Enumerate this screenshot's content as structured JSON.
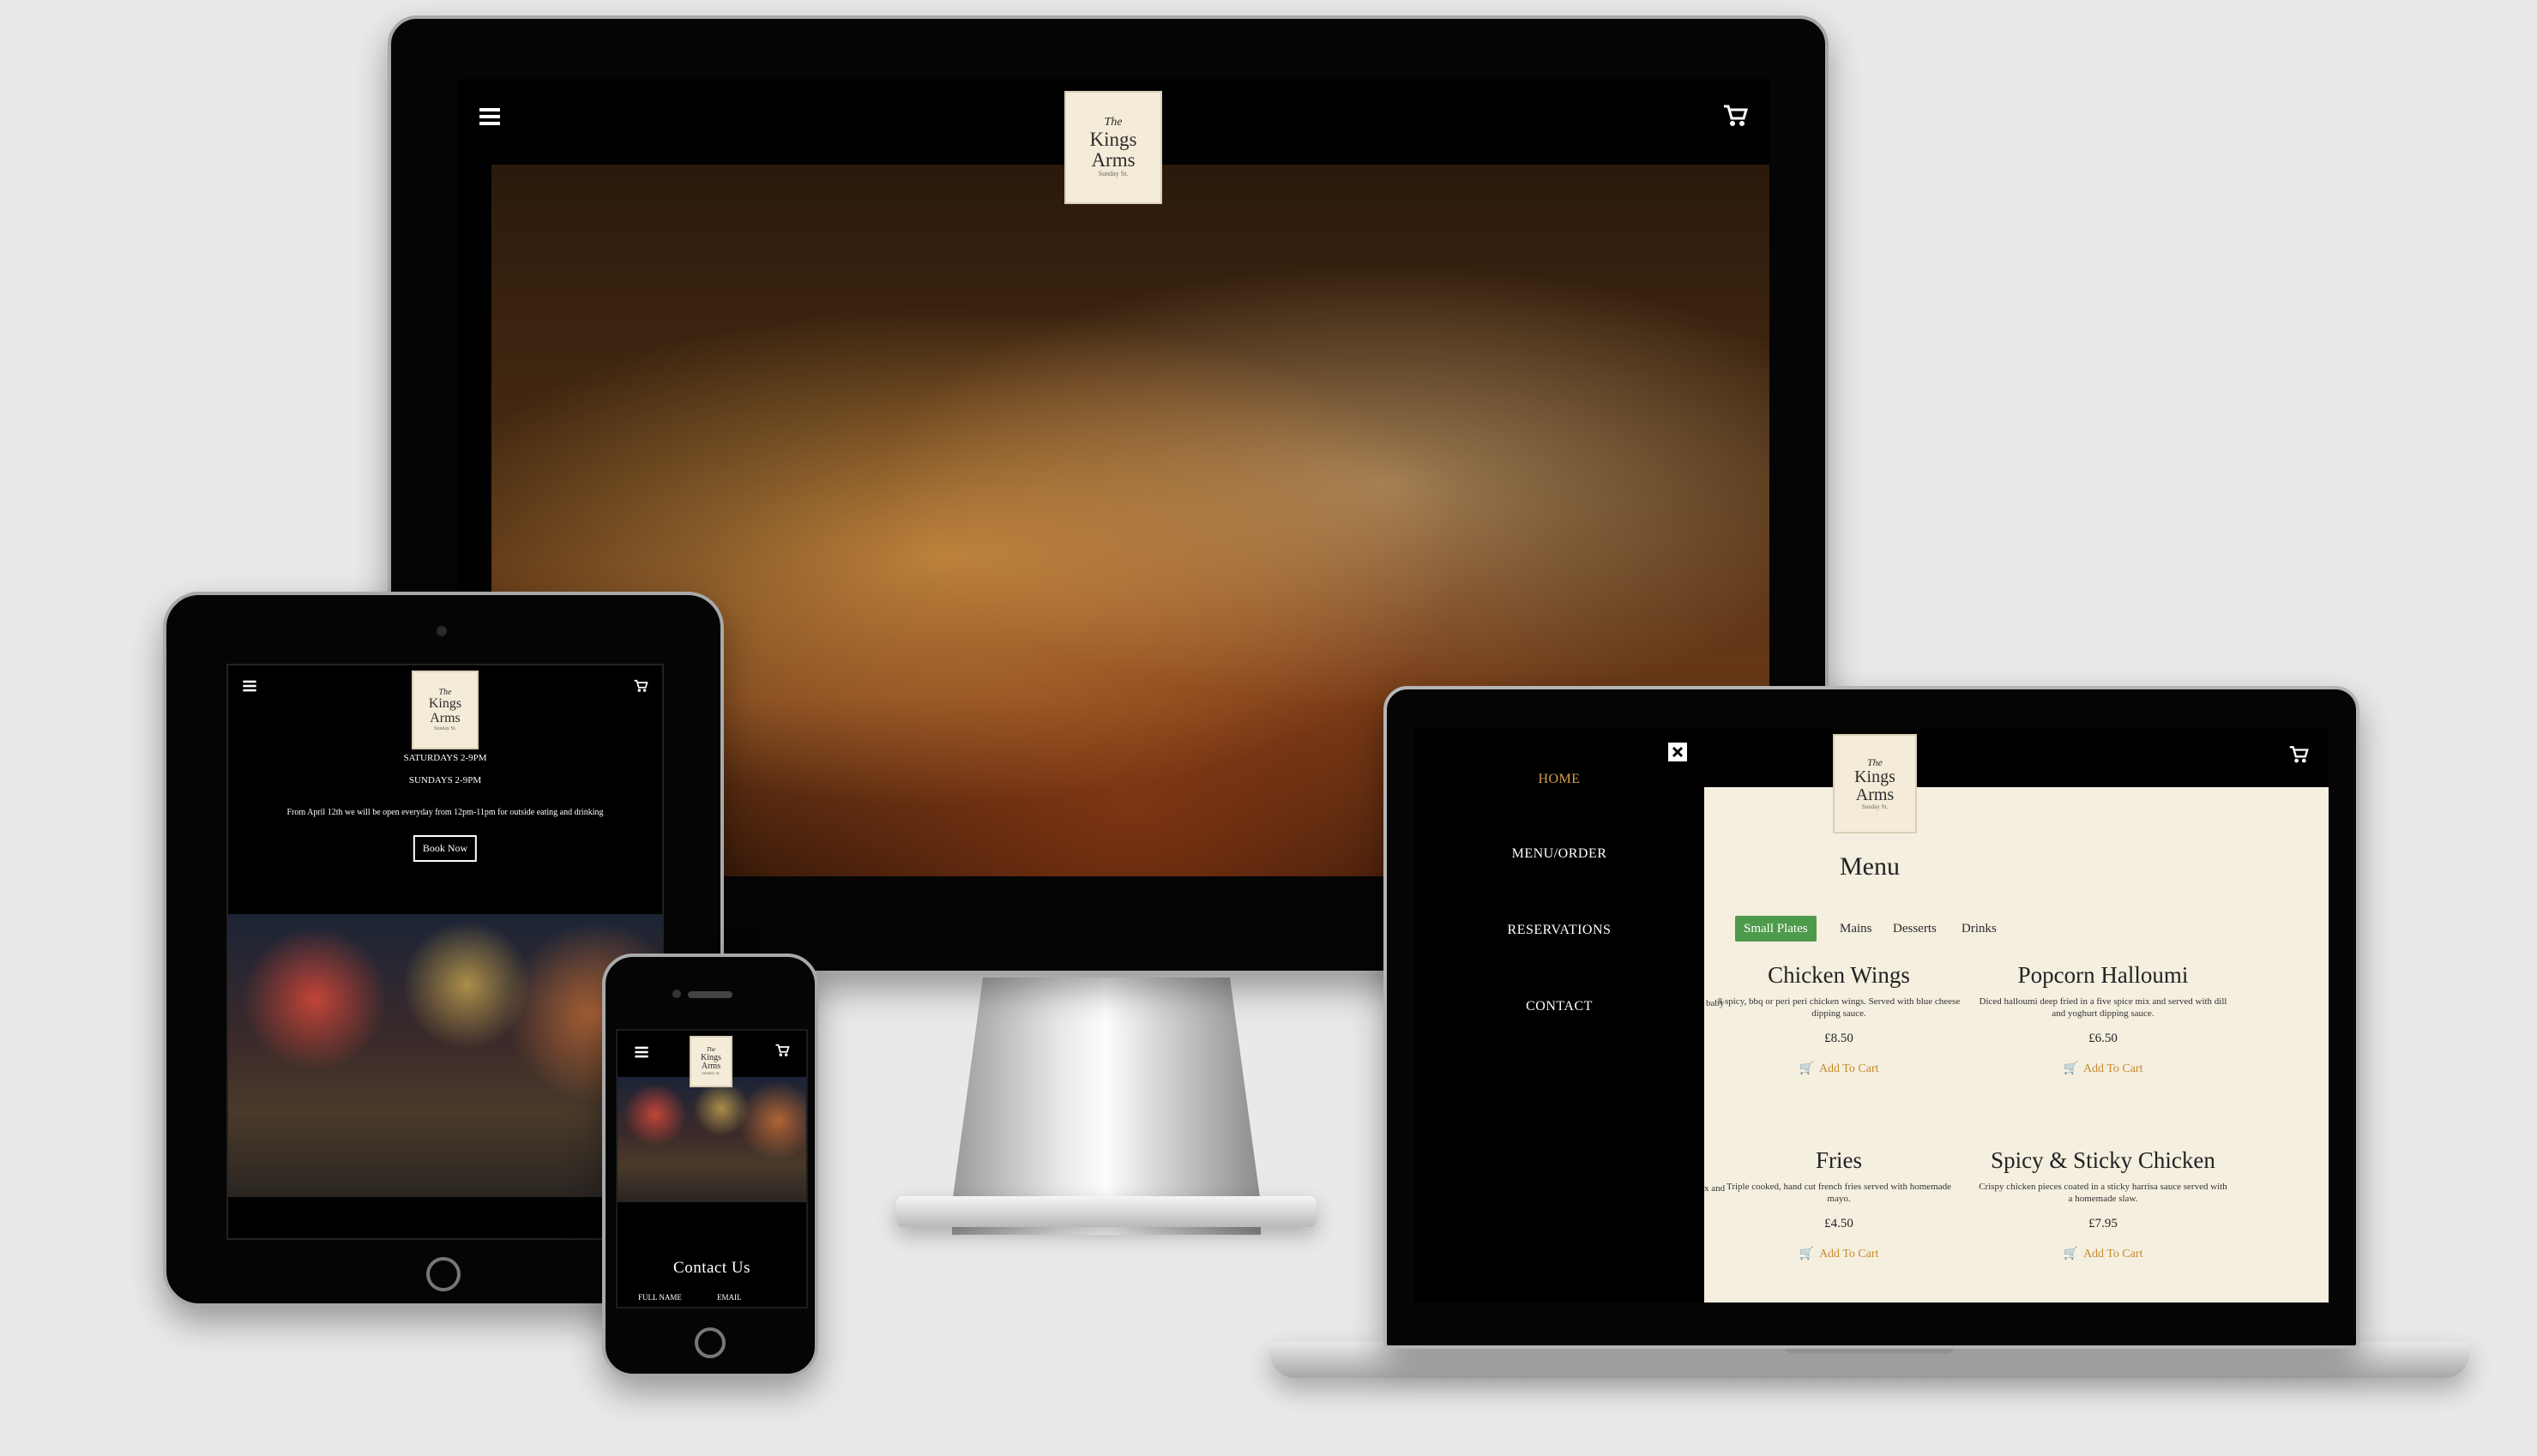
{
  "brand": {
    "logo_the": "The",
    "logo_line1": "Kings",
    "logo_line2": "Arms",
    "logo_small": "Sunday St."
  },
  "icons": {
    "menu": "hamburger-icon",
    "cart": "cart-icon",
    "close": "close-icon"
  },
  "colors": {
    "accent": "#d4a04a",
    "panel": "#f5efe0",
    "active_tab": "#4c9a4a"
  },
  "laptop": {
    "nav": [
      {
        "label": "HOME",
        "active": true
      },
      {
        "label": "MENU/ORDER",
        "active": false
      },
      {
        "label": "RESERVATIONS",
        "active": false
      },
      {
        "label": "CONTACT",
        "active": false
      }
    ],
    "menu_title": "Menu",
    "tabs": [
      "Small Plates",
      "Mains",
      "Desserts",
      "Drinks"
    ],
    "left_fragments": [
      "baby",
      "x and"
    ],
    "items": [
      {
        "name": "Chicken Wings",
        "description": "8 spicy, bbq or peri peri chicken wings. Served with blue cheese dipping sauce.",
        "price": "£8.50",
        "add": "Add To Cart"
      },
      {
        "name": "Popcorn Halloumi",
        "description": "Diced halloumi deep fried in a five spice mix and served with dill and yoghurt dipping sauce.",
        "price": "£6.50",
        "add": "Add To Cart"
      },
      {
        "name": "Fries",
        "description": "Triple cooked, hand cut french fries served with homemade mayo.",
        "price": "£4.50",
        "add": "Add To Cart"
      },
      {
        "name": "Spicy & Sticky Chicken",
        "description": "Crispy chicken pieces coated in a sticky harrisa sauce served with a homemade slaw.",
        "price": "£7.95",
        "add": "Add To Cart"
      }
    ]
  },
  "tablet": {
    "line1": "SATURDAYS 2-9PM",
    "line2": "SUNDAYS 2-9PM",
    "notice": "From April 12th we will be open everyday from 12pm-11pm for outside eating and drinking",
    "book_button": "Book Now"
  },
  "phone": {
    "contact_title": "Contact Us",
    "field1": "FULL NAME",
    "field2": "EMAIL"
  }
}
